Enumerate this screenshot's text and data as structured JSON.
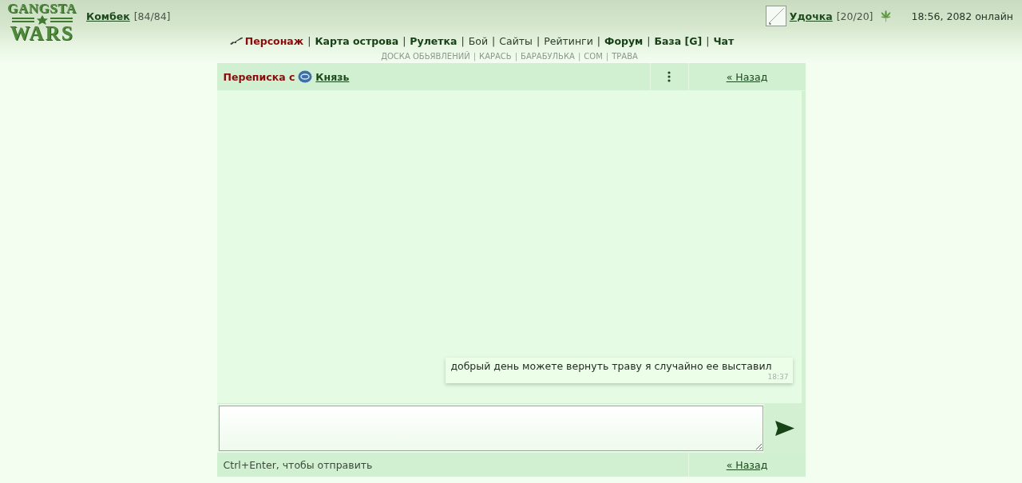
{
  "logo": {
    "top_word": "GANGSTA",
    "bottom_word": "WARS"
  },
  "player": {
    "name": "Комбек",
    "health": "[84/84]"
  },
  "equipped_item": {
    "name": "Удочка",
    "durability": "[20/20]"
  },
  "server_status": "18:56, 2082 онлайн",
  "nav": {
    "separator": "|",
    "items": [
      {
        "label": "Персонаж",
        "bold": true,
        "selected": true
      },
      {
        "label": "Карта острова",
        "bold": true,
        "selected": false
      },
      {
        "label": "Рулетка",
        "bold": true,
        "selected": false
      },
      {
        "label": "Бой",
        "bold": false,
        "selected": false
      },
      {
        "label": "Сайты",
        "bold": false,
        "selected": false
      },
      {
        "label": "Рейтинги",
        "bold": false,
        "selected": false
      },
      {
        "label": "Форум",
        "bold": true,
        "selected": false
      },
      {
        "label": "База [G]",
        "bold": true,
        "selected": false
      },
      {
        "label": "Чат",
        "bold": true,
        "selected": false
      }
    ]
  },
  "subnav": {
    "separator": "|",
    "items": [
      "ДОСКА ОБЬЯВЛЕНИЙ",
      "КАРАСЬ",
      "БАРАБУЛЬКА",
      "СОМ",
      "ТРАВА"
    ]
  },
  "conversation": {
    "title": "Переписка с",
    "partner": "Князь",
    "back_link": "« Назад"
  },
  "messages": [
    {
      "text": "добрый день можете вернуть траву я случайно ее выставил",
      "time": "18:37",
      "outgoing": true
    }
  ],
  "composer": {
    "hint": "Ctrl+Enter, чтобы отправить",
    "back_link": "« Назад"
  }
}
